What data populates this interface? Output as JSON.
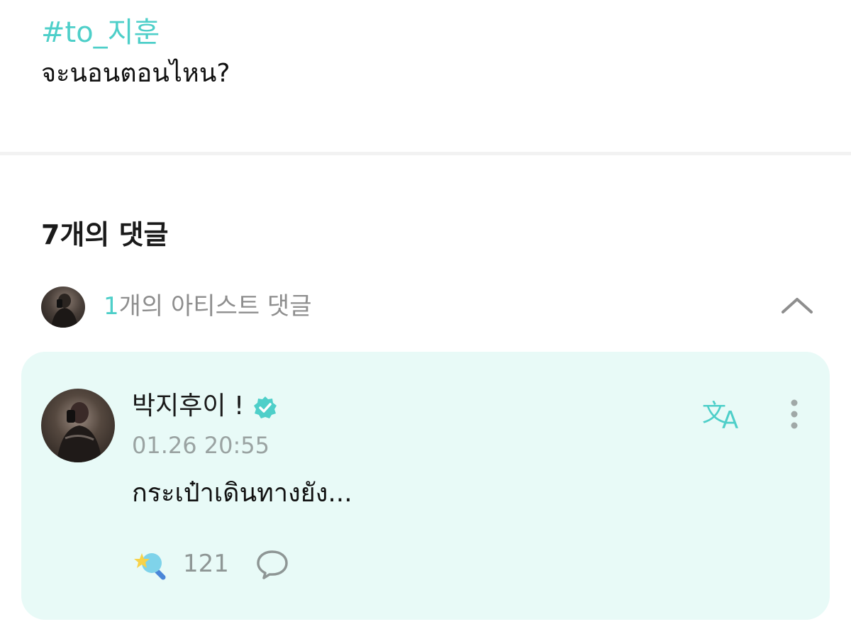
{
  "post": {
    "hashtag": "#to_지훈",
    "text": "จะนอนตอนไหน?"
  },
  "comments": {
    "title": "7개의 댓글",
    "artist_count_num": "1",
    "artist_count_suffix": "개의 아티스트 댓글"
  },
  "artist_comment": {
    "author": "박지후이 !",
    "timestamp": "01.26 20:55",
    "text": "กระเป๋าเดินทางยัง...",
    "like_count": "121"
  },
  "colors": {
    "accent": "#4ecfc9",
    "card_bg": "#e8faf7",
    "muted_text": "#8e8e8e"
  },
  "icons": {
    "collapse": "chevron-up-icon",
    "verified": "verified-badge-icon",
    "translate": "translate-icon",
    "more": "more-vertical-icon",
    "like": "star-lightstick-icon",
    "reply": "speech-bubble-icon"
  }
}
